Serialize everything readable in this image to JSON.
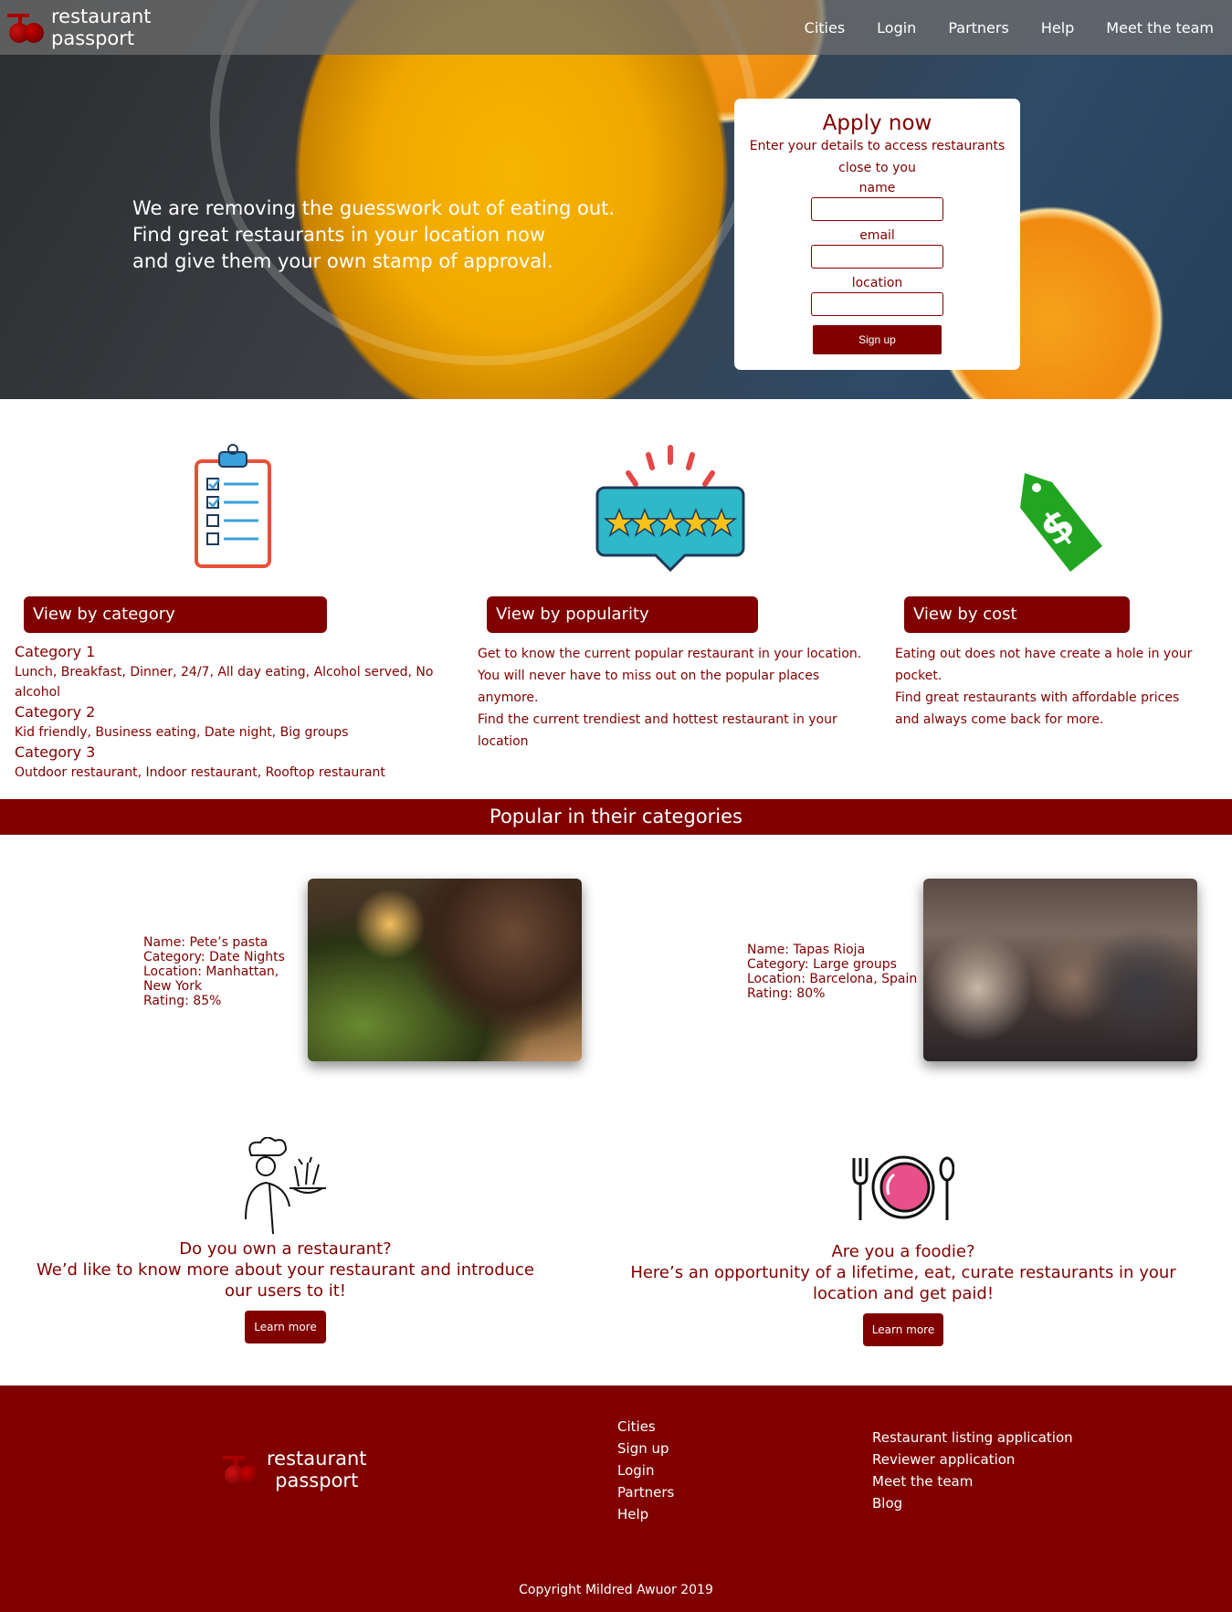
{
  "brand": {
    "line1": "restaurant",
    "line2": "passport"
  },
  "nav": {
    "items": [
      "Cities",
      "Login",
      "Partners",
      "Help",
      "Meet the team"
    ]
  },
  "hero": {
    "tagline": [
      "We are removing the guesswork out of eating out.",
      "Find great restaurants in your location now",
      "and give them your own stamp of approval."
    ]
  },
  "apply": {
    "title": "Apply now",
    "subtitle": "Enter your details to access restaurants close to you",
    "name_label": "name",
    "email_label": "email",
    "location_label": "location",
    "button": "Sign up"
  },
  "features": {
    "category": {
      "pill": "View by category",
      "items": [
        {
          "title": "Category 1",
          "desc": "Lunch, Breakfast, Dinner, 24/7, All day eating, Alcohol served, No alcohol"
        },
        {
          "title": "Category 2",
          "desc": "Kid friendly, Business eating, Date night, Big groups"
        },
        {
          "title": "Category 3",
          "desc": "Outdoor restaurant, Indoor restaurant, Rooftop restaurant"
        }
      ]
    },
    "popularity": {
      "pill": "View by popularity",
      "text1": "Get to know the current popular restaurant in your location. You will never have to miss out on the popular places anymore.",
      "text2": "Find the current trendiest and hottest restaurant in your location"
    },
    "cost": {
      "pill": "View by cost",
      "text1": "Eating out does not have create a hole in your pocket.",
      "text2": "Find great restaurants with affordable prices and always come back for more."
    }
  },
  "popular": {
    "banner": "Popular in their categories",
    "cards": [
      {
        "name": "Name: Pete’s pasta",
        "category": "Category: Date Nights",
        "location": "Location: Manhattan, New York",
        "rating": "Rating: 85%"
      },
      {
        "name": "Name: Tapas Rioja",
        "category": "Category: Large groups",
        "location": "Location: Barcelona, Spain",
        "rating": "Rating: 80%"
      }
    ]
  },
  "cta": {
    "owner": {
      "q": "Do you own a restaurant?",
      "text": "We’d like to know more about your restaurant and introduce our users to it!",
      "button": "Learn more"
    },
    "foodie": {
      "q": "Are you a foodie?",
      "text": "Here’s an opportunity of a lifetime, eat, curate restaurants in your location and get paid!",
      "button": "Learn more"
    }
  },
  "footer": {
    "links1": [
      "Cities",
      "Sign up",
      "Login",
      "Partners",
      "Help"
    ],
    "links2": [
      "Restaurant listing application",
      "Reviewer application",
      "Meet the team",
      "Blog"
    ],
    "copyright": "Copyright Mildred Awuor 2019"
  },
  "colors": {
    "brand": "#800000",
    "white": "#ffffff"
  }
}
